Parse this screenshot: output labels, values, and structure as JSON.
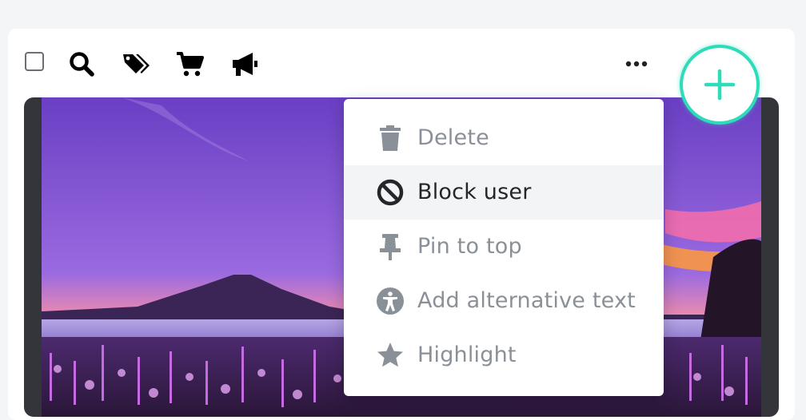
{
  "toolbar": {
    "icons": [
      "checkbox-icon",
      "search-icon",
      "tags-icon",
      "cart-icon",
      "megaphone-icon",
      "more-horizontal-icon"
    ]
  },
  "fab": {
    "icon": "plus-icon",
    "accent": "#2fdcba"
  },
  "menu": {
    "items": [
      {
        "label": "Delete",
        "icon": "trash-icon",
        "state": "disabled"
      },
      {
        "label": "Block user",
        "icon": "block-icon",
        "state": "hover"
      },
      {
        "label": "Pin to top",
        "icon": "pin-icon",
        "state": "disabled"
      },
      {
        "label": "Add alternative text",
        "icon": "accessibility-icon",
        "state": "disabled"
      },
      {
        "label": "Highlight",
        "icon": "star-icon",
        "state": "disabled"
      }
    ]
  },
  "colors": {
    "active_text": "#23262b",
    "muted_text": "#8a9097",
    "hover_bg": "#f3f4f6"
  }
}
